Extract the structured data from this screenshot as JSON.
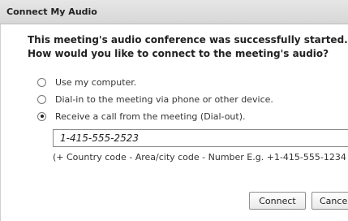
{
  "dialog": {
    "title": "Connect My Audio",
    "intro_line1": "This meeting's audio conference was successfully started.",
    "intro_line2": "How would you like to connect to the meeting's audio?"
  },
  "options": [
    {
      "label": "Use my computer.",
      "selected": false
    },
    {
      "label": "Dial-in to the meeting via phone or other device.",
      "selected": false
    },
    {
      "label": "Receive a call from the meeting (Dial-out).",
      "selected": true
    }
  ],
  "phone_field": {
    "value": "1-415-555-2523"
  },
  "hint": "(+ Country code - Area/city code - Number E.g. +1-415-555-1234",
  "buttons": {
    "connect": "Connect",
    "cancel": "Cancel"
  }
}
